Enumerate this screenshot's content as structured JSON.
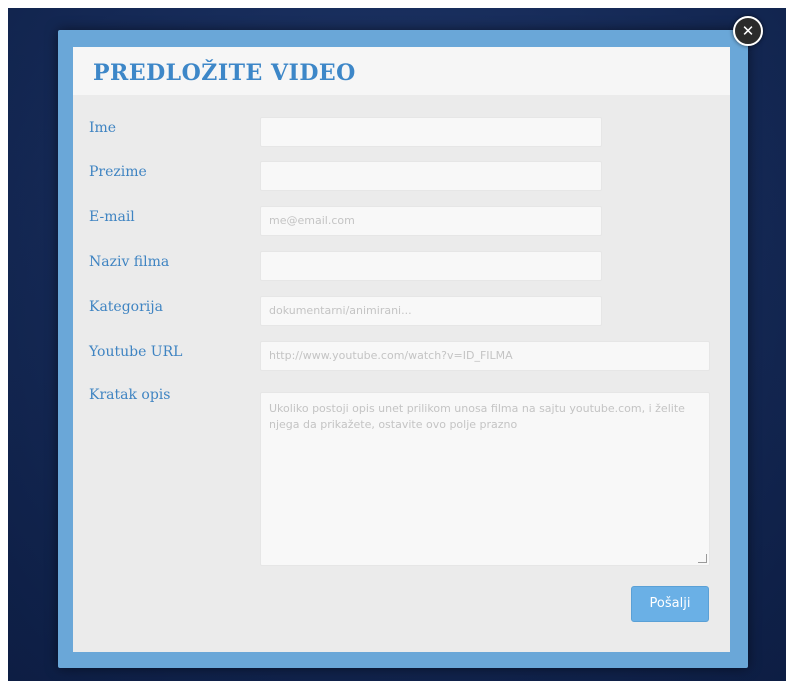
{
  "dialog": {
    "title": "PREDLOŽITE VIDEO",
    "close_icon": "close-icon",
    "fields": [
      {
        "label": "Ime",
        "placeholder": ""
      },
      {
        "label": "Prezime",
        "placeholder": ""
      },
      {
        "label": "E-mail",
        "placeholder": "me@email.com"
      },
      {
        "label": "Naziv filma",
        "placeholder": ""
      },
      {
        "label": "Kategorija",
        "placeholder": "dokumentarni/animirani..."
      },
      {
        "label": "Youtube URL",
        "placeholder": "http://www.youtube.com/watch?v=ID_FILMA"
      },
      {
        "label": "Kratak opis",
        "placeholder": "Ukoliko postoji opis unet prilikom unosa filma na sajtu youtube.com, i želite njega da prikažete, ostavite ovo polje prazno"
      }
    ],
    "submit_label": "Pošalji"
  },
  "colors": {
    "accent": "#3d87c8",
    "frame": "#6aa7d8",
    "button": "#6ab0e6",
    "backdrop": "#1a2f5e"
  }
}
